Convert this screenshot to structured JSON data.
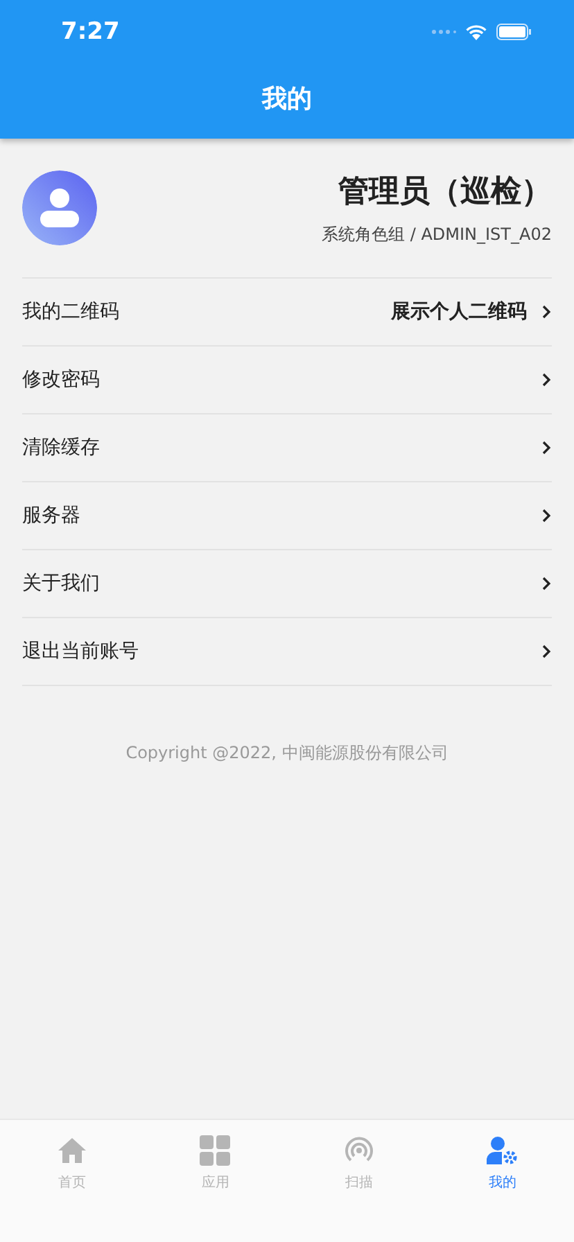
{
  "status_bar": {
    "time": "7:27"
  },
  "header": {
    "title": "我的"
  },
  "profile": {
    "name": "管理员（巡检）",
    "role": "系统角色组 / ADMIN_IST_A02"
  },
  "menu": [
    {
      "label": "我的二维码",
      "value": "展示个人二维码"
    },
    {
      "label": "修改密码"
    },
    {
      "label": "清除缓存"
    },
    {
      "label": "服务器"
    },
    {
      "label": "关于我们"
    },
    {
      "label": "退出当前账号"
    }
  ],
  "footer": {
    "copyright": "Copyright @2022, 中闽能源股份有限公司"
  },
  "tab_bar": [
    {
      "kind": "home",
      "label": "首页",
      "selected": false
    },
    {
      "kind": "apps",
      "label": "应用",
      "selected": false
    },
    {
      "kind": "signal",
      "label": "扫描",
      "selected": false
    },
    {
      "kind": "user",
      "label": "我的",
      "selected": true
    }
  ]
}
